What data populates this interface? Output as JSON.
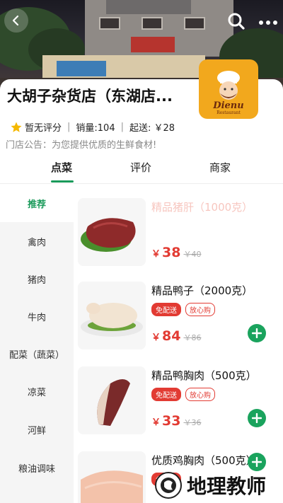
{
  "header": {
    "back_icon": "chevron-left-icon",
    "search_icon": "search-icon",
    "more_icon": "ellipsis-icon"
  },
  "store": {
    "name": "大胡子杂货店（东湖店...",
    "logo_text": "Dienu",
    "logo_subtext": "Restaurant",
    "rating_icon": "star-icon",
    "rating_text": "暂无评分",
    "sales_text": "销量:104",
    "min_order_text": "起送: ￥28",
    "notice": "门店公告：为您提供优质的生鲜食材!",
    "accent_color": "#1a9a5a",
    "logo_color": "#f2a81d"
  },
  "tabs": [
    {
      "label": "点菜",
      "active": true
    },
    {
      "label": "评价",
      "active": false
    },
    {
      "label": "商家",
      "active": false
    }
  ],
  "sidebar": {
    "items": [
      {
        "label": "推荐",
        "active": true
      },
      {
        "label": "禽肉",
        "active": false
      },
      {
        "label": "猪肉",
        "active": false
      },
      {
        "label": "牛肉",
        "active": false
      },
      {
        "label": "配菜（蔬菜）",
        "active": false
      },
      {
        "label": "凉菜",
        "active": false
      },
      {
        "label": "河鲜",
        "active": false
      },
      {
        "label": "粮油调味",
        "active": false
      }
    ]
  },
  "products": [
    {
      "name": "精品猪肝（1000克）",
      "currency": "￥",
      "price": "38",
      "old_price": "￥40",
      "tags": [],
      "show_add": false
    },
    {
      "name": "精品鸭子（2000克）",
      "currency": "￥",
      "price": "84",
      "old_price": "￥86",
      "tags": [
        "免配送",
        "放心购"
      ],
      "show_add": true
    },
    {
      "name": "精品鸭胸肉（500克）",
      "currency": "￥",
      "price": "33",
      "old_price": "￥36",
      "tags": [
        "免配送",
        "放心购"
      ],
      "show_add": true
    },
    {
      "name": "优质鸡胸肉（500克）",
      "currency": "￥",
      "price": "",
      "old_price": "",
      "tags": [
        "免配送"
      ],
      "show_add": true
    }
  ],
  "watermark": {
    "text": "地理教师",
    "badge_icon": "geography-badge-icon"
  },
  "colors": {
    "price_red": "#e23b33",
    "add_green": "#1aa35d"
  }
}
